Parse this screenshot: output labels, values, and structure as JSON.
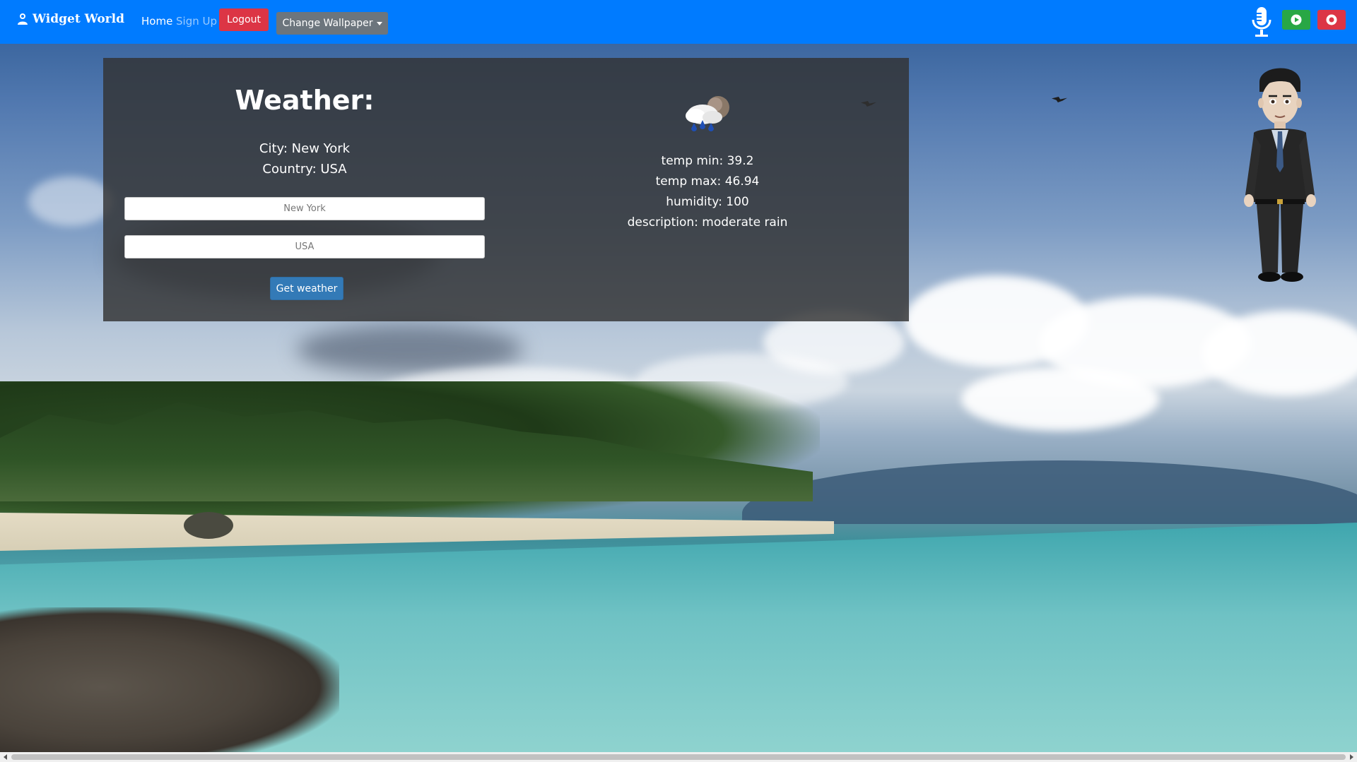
{
  "navbar": {
    "brand": "Widget World",
    "brand_icon": "user-icon",
    "links": [
      "Home",
      "Sign Up"
    ],
    "logout_label": "Logout",
    "wallpaper_label": "Change Wallpaper",
    "mic_icon": "microphone-icon",
    "play_icon": "play-icon",
    "record_icon": "record-icon",
    "accent": "#007bff"
  },
  "weather": {
    "title": "Weather:",
    "city_text": "City: New York",
    "country_text": "Country: USA",
    "city_input_placeholder": "New York",
    "country_input_placeholder": "USA",
    "button_label": "Get weather",
    "icon": "rain-cloud-icon",
    "temp_min": "temp min: 39.2",
    "temp_max": "temp max: 46.94",
    "humidity": "humidity: 100",
    "description": "description: moderate rain"
  },
  "colors": {
    "danger": "#dc3545",
    "success": "#28a745",
    "secondary": "#6c757d",
    "primary_button": "#337ab7"
  }
}
